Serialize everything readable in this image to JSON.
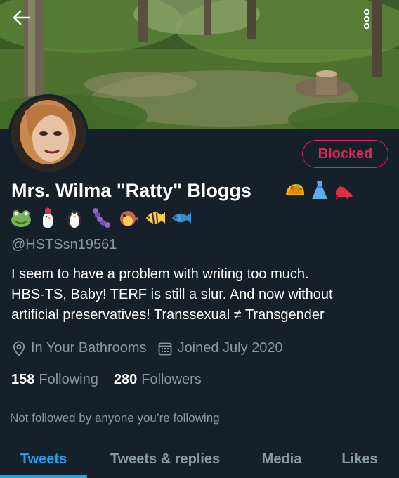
{
  "header": {
    "back_icon": "arrow-left-icon",
    "more_icon": "vertical-dots-icon"
  },
  "profile": {
    "action_button": "Blocked",
    "display_name": "Mrs. Wilma \"Ratty\" Bloggs",
    "name_emojis": [
      "taco",
      "dress",
      "high-heel"
    ],
    "emoji_line": [
      "frog",
      "chicken",
      "penguin",
      "caterpillar",
      "blowfish",
      "tropical-fish",
      "fish"
    ],
    "handle": "@HSTSsn19561",
    "bio_lines": [
      "I seem to have a problem with writing too much.",
      "HBS-TS, Baby!  TERF is still a slur.  And now without",
      "artificial preservatives!  Transsexual ≠ Transgender"
    ],
    "location": "In Your Bathrooms",
    "joined": "Joined July 2020",
    "following_count": "158",
    "following_label": "Following",
    "followers_count": "280",
    "followers_label": "Followers",
    "not_followed_note": "Not followed by anyone you’re following"
  },
  "tabs": [
    {
      "label": "Tweets",
      "active": true
    },
    {
      "label": "Tweets & replies",
      "active": false
    },
    {
      "label": "Media",
      "active": false
    },
    {
      "label": "Likes",
      "active": false
    }
  ],
  "colors": {
    "background": "#15202b",
    "accent": "#1da1f2",
    "blocked": "#e0245e",
    "secondary_text": "#8899a6"
  }
}
